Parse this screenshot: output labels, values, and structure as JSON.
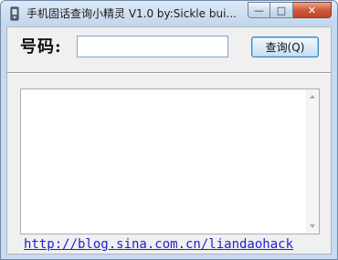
{
  "window": {
    "title": "手机固话查询小精灵 V1.0  by:Sickle  bui...",
    "minimize_glyph": "—",
    "maximize_glyph": "□",
    "close_glyph": "✕"
  },
  "form": {
    "phone_label": "号码:",
    "phone_value": "",
    "query_button": "查询(Q)"
  },
  "results": {
    "text": ""
  },
  "footer": {
    "link_text": "http://blog.sina.com.cn/liandaohack"
  },
  "colors": {
    "link": "#1f1fd6",
    "close_button": "#cf5a3c"
  }
}
